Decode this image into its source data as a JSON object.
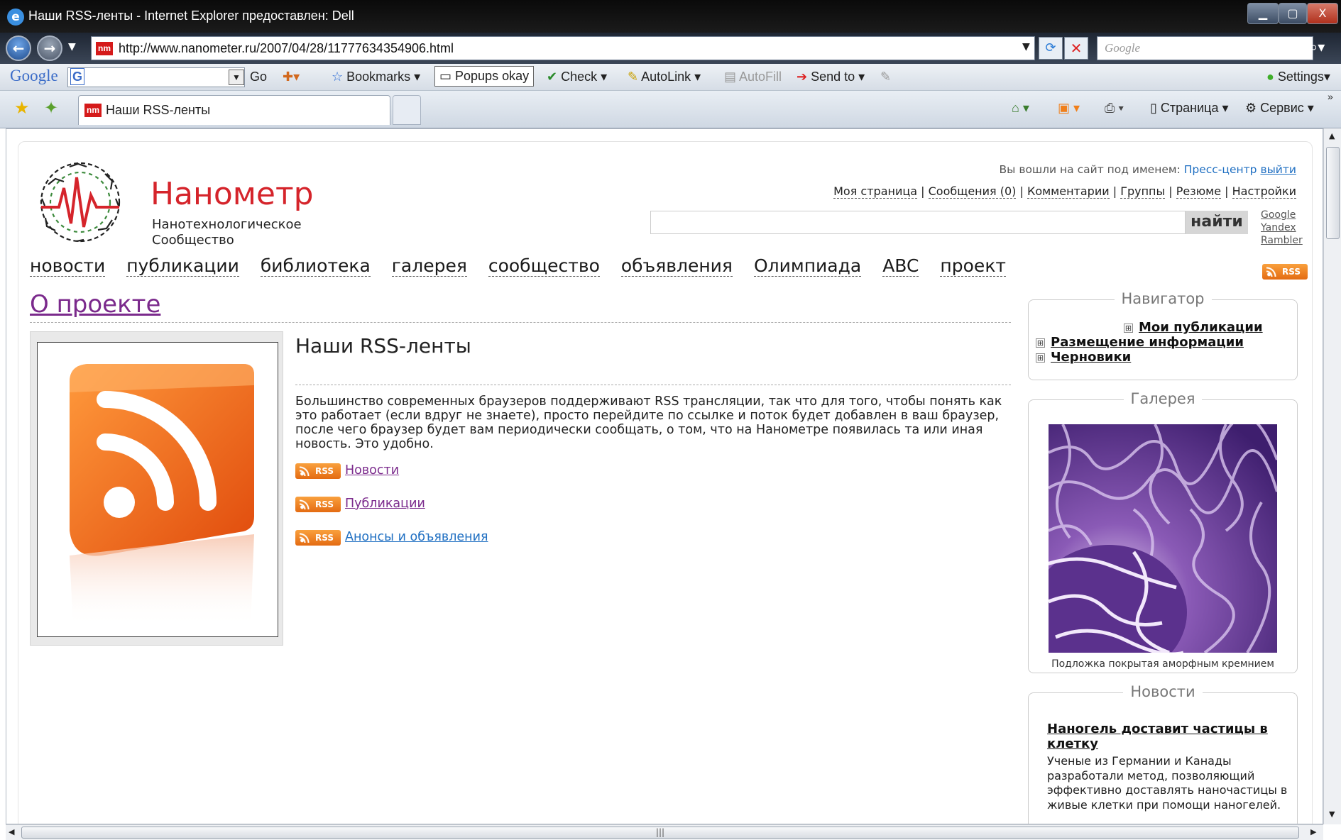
{
  "window": {
    "title": "Наши RSS-ленты - Internet Explorer предоставлен: Dell",
    "controls": [
      "▁",
      "▢",
      "X"
    ]
  },
  "address_bar": {
    "url": "http://www.nanometer.ru/2007/04/28/11777634354906.html",
    "search_placeholder": "Google"
  },
  "google_toolbar": {
    "logo": "Google",
    "go": "Go",
    "bookmarks": "Bookmarks",
    "popups": "Popups okay",
    "check": "Check",
    "autolink": "AutoLink",
    "autofill": "AutoFill",
    "sendto": "Send to",
    "settings": "Settings"
  },
  "tabs": {
    "active_tab": "Наши RSS-ленты",
    "favicon": "nm"
  },
  "command_bar": {
    "page": "Страница",
    "tools": "Сервис"
  },
  "site": {
    "logo_name": "Нанометр",
    "logo_sub_1": "Нанотехнологическое",
    "logo_sub_2": "Сообщество",
    "login_text": "Вы вошли на сайт под именем:",
    "username": "Пресс-центр",
    "logout": "выйти",
    "user_links": [
      "Моя страница",
      "Сообщения (0)",
      "Комментарии",
      "Группы",
      "Резюме",
      "Настройки"
    ],
    "search_button": "найти",
    "search_engines": [
      "Google",
      "Yandex",
      "Rambler"
    ],
    "main_nav": [
      "новости",
      "публикации",
      "библиотека",
      "галерея",
      "сообщество",
      "объявления",
      "Олимпиада",
      "ABC",
      "проект"
    ],
    "rss_badge": "RSS"
  },
  "content": {
    "section_title": "О проекте",
    "article_title": "Наши RSS-ленты",
    "body": "Большинство современных браузеров поддерживают RSS трансляции, так что для того, чтобы понять как это работает (если вдруг не знаете), просто перейдите по ссылке и поток будет добавлен в ваш браузер, после чего браузер будет вам периодически сообщать, о том, что на Нанометре появилась та или иная новость. Это удобно.",
    "feeds": [
      {
        "label": "Новости",
        "color": "#7b2a8c"
      },
      {
        "label": "Публикации",
        "color": "#7b2a8c"
      },
      {
        "label": "Анонсы и объявления",
        "color": "#1f6fc2"
      }
    ]
  },
  "sidebar": {
    "navigator": {
      "title": "Навигатор",
      "items": [
        "Мои публикации",
        "Размещение информации",
        "Черновики"
      ],
      "toggle": "⊞"
    },
    "gallery": {
      "title": "Галерея",
      "caption": "Подложка покрытая аморфным кремнием"
    },
    "news": {
      "title": "Новости",
      "headline": "Наногель доставит частицы в клетку",
      "text": "Ученые из Германии и Канады разработали метод, позволяющий эффективно доставлять наночастицы в живые клетки при помощи наногелей."
    }
  },
  "colors": {
    "logo_red": "#d5242b",
    "link_purple": "#7b2a8c",
    "link_blue": "#1f6fc2",
    "rss_orange": "#f2821f"
  },
  "icons": [
    "ie-icon",
    "back-icon",
    "forward-icon",
    "refresh-icon",
    "stop-icon",
    "search-icon",
    "star-icon",
    "add-favorite-icon",
    "home-icon",
    "feeds-icon",
    "print-icon",
    "page-icon",
    "tools-icon",
    "rss-icon",
    "gallery-image"
  ]
}
